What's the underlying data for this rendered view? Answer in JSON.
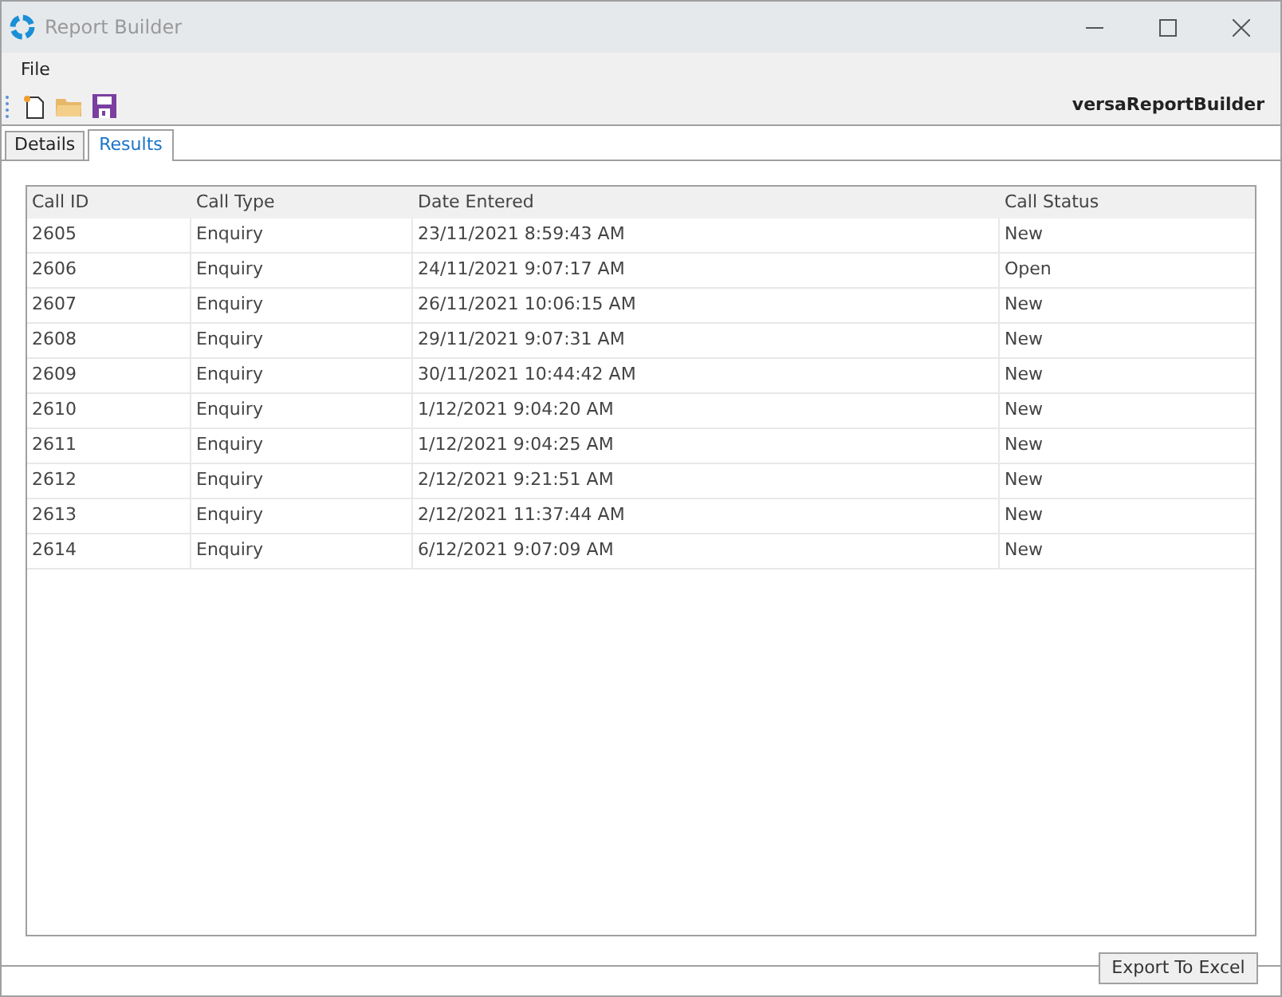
{
  "window": {
    "title": "Report Builder"
  },
  "menu": [
    "File"
  ],
  "toolbar": {
    "brand": "versaReportBuilder"
  },
  "tabs": [
    {
      "label": "Details",
      "selected": false
    },
    {
      "label": "Results",
      "selected": true
    }
  ],
  "table": {
    "columns": [
      "Call ID",
      "Call Type",
      "Date Entered",
      "Call Status"
    ],
    "rows": [
      [
        "2605",
        "Enquiry",
        "23/11/2021 8:59:43 AM",
        "New"
      ],
      [
        "2606",
        "Enquiry",
        "24/11/2021 9:07:17 AM",
        "Open"
      ],
      [
        "2607",
        "Enquiry",
        "26/11/2021 10:06:15 AM",
        "New"
      ],
      [
        "2608",
        "Enquiry",
        "29/11/2021 9:07:31 AM",
        "New"
      ],
      [
        "2609",
        "Enquiry",
        "30/11/2021 10:44:42 AM",
        "New"
      ],
      [
        "2610",
        "Enquiry",
        "1/12/2021 9:04:20 AM",
        "New"
      ],
      [
        "2611",
        "Enquiry",
        "1/12/2021 9:04:25 AM",
        "New"
      ],
      [
        "2612",
        "Enquiry",
        "2/12/2021 9:21:51 AM",
        "New"
      ],
      [
        "2613",
        "Enquiry",
        "2/12/2021 11:37:44 AM",
        "New"
      ],
      [
        "2614",
        "Enquiry",
        "6/12/2021 9:07:09 AM",
        "New"
      ]
    ]
  },
  "buttons": [
    "Export To Excel"
  ]
}
